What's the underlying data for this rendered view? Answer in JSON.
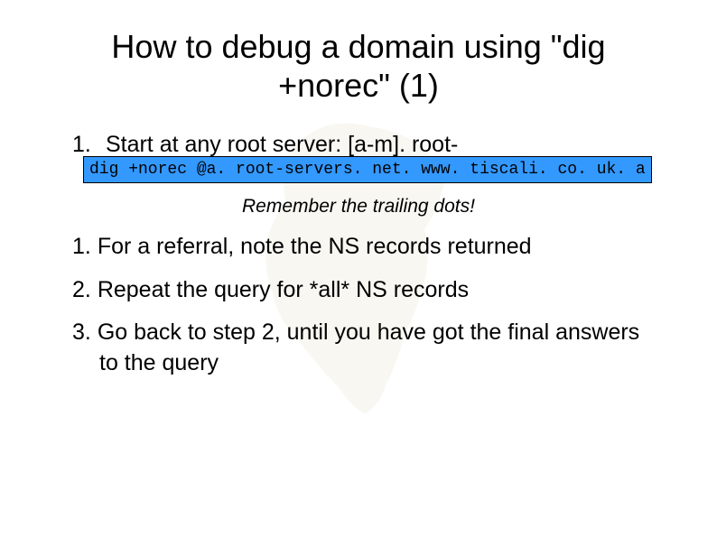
{
  "title": "How to debug a domain using \"dig +norec\" (1)",
  "step1": {
    "num": "1.",
    "text": "Start at any root server: [a-m]. root-"
  },
  "code": "dig +norec @a. root-servers. net. www. tiscali. co. uk. a",
  "note": "Remember the trailing dots!",
  "steps": [
    {
      "num": "1.",
      "text": "For a referral, note the NS records returned"
    },
    {
      "num": "2.",
      "text": "Repeat the query for *all* NS records"
    },
    {
      "num": "3.",
      "text": "Go back to step 2, until you have got the final answers to the query"
    }
  ]
}
